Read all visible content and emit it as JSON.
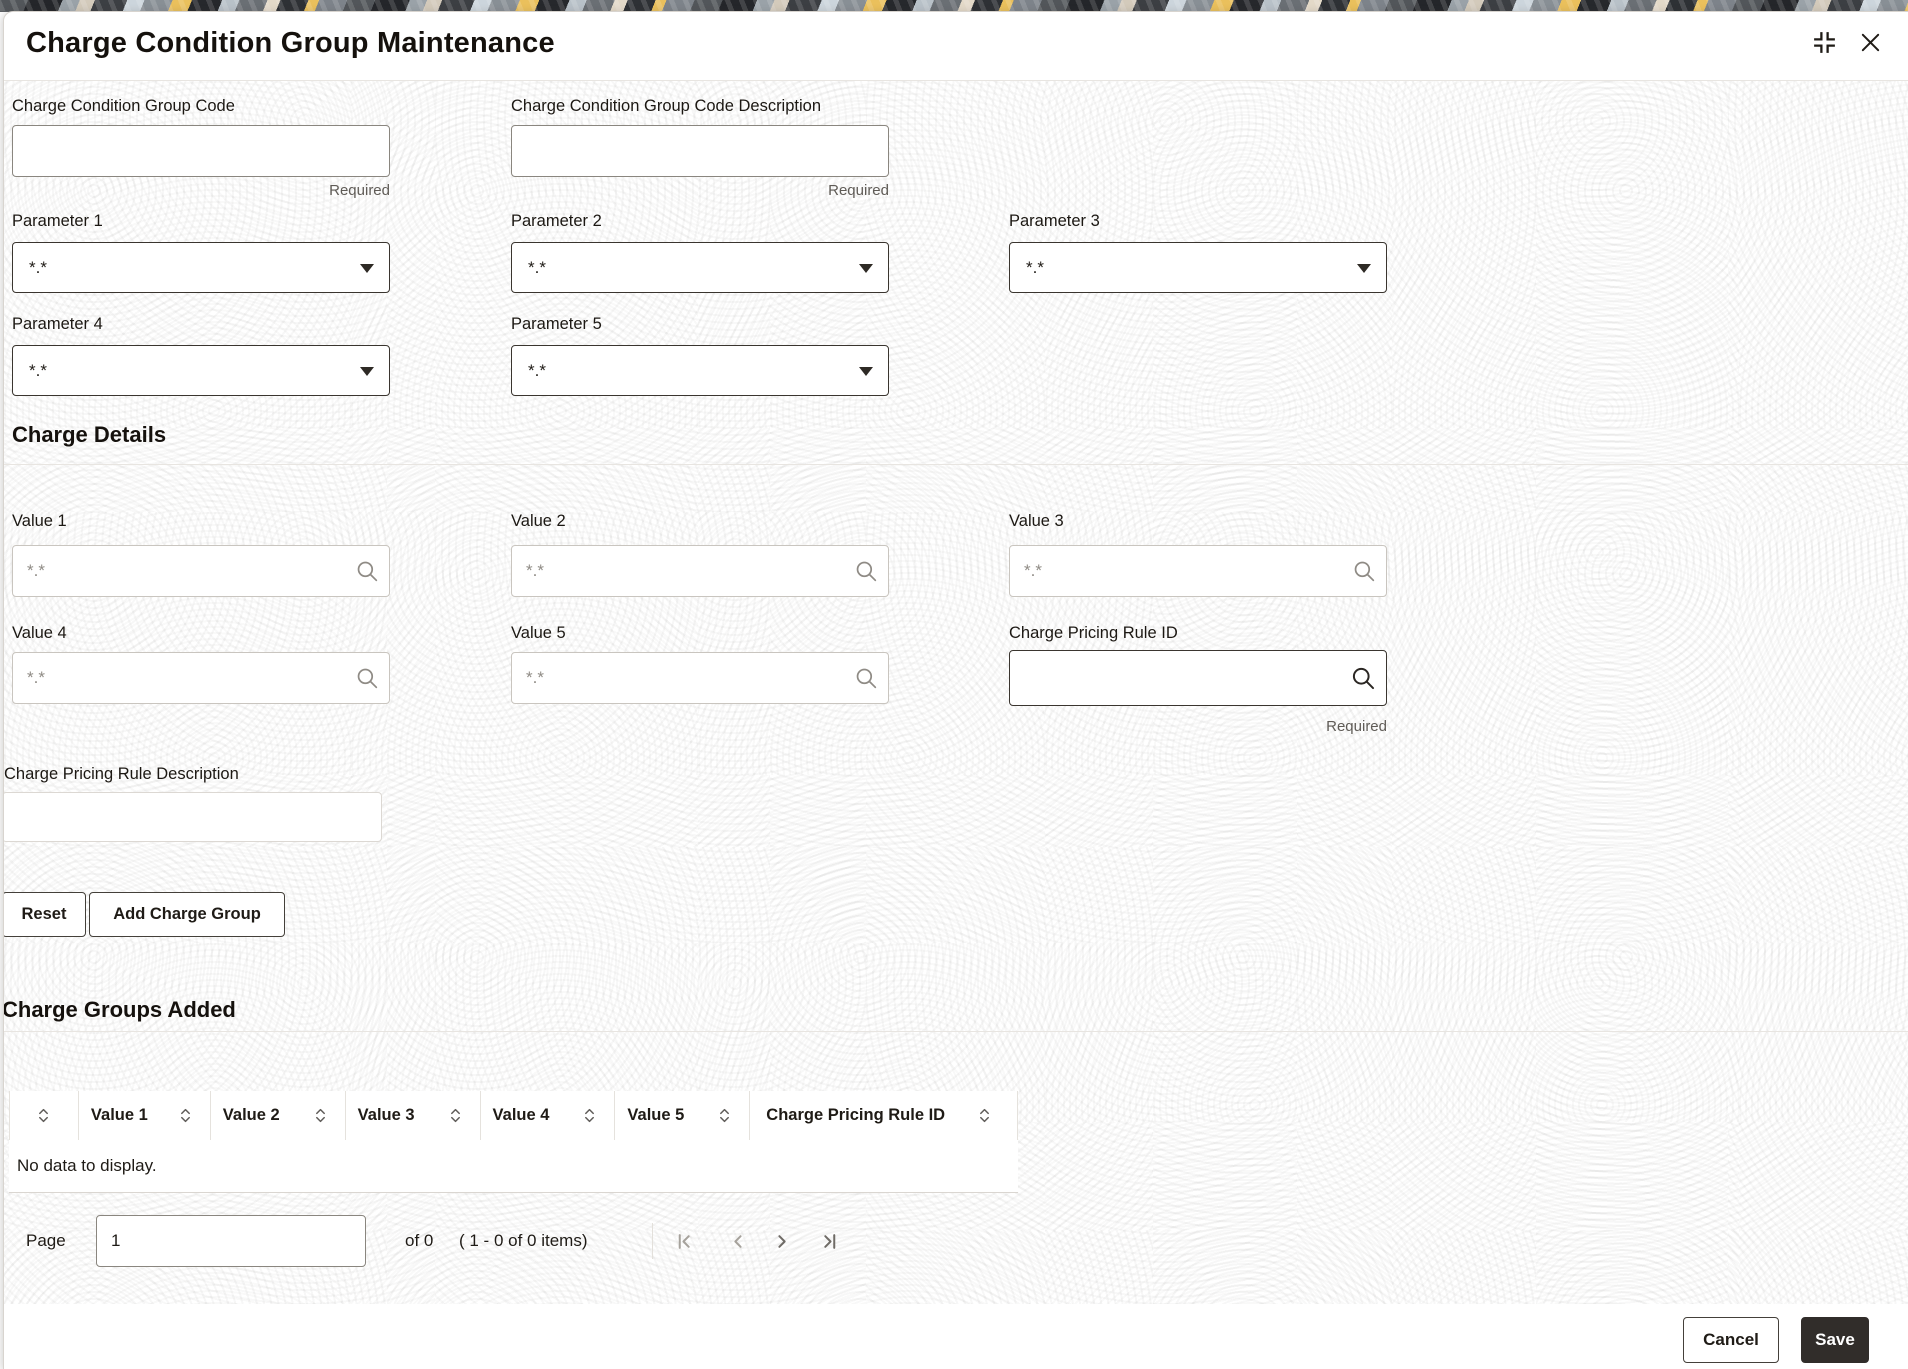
{
  "dialog_title": "Charge Condition Group Maintenance",
  "form": {
    "group_code": {
      "label": "Charge Condition Group Code",
      "value": "",
      "required_hint": "Required"
    },
    "group_code_description": {
      "label": "Charge Condition Group Code Description",
      "value": "",
      "required_hint": "Required"
    }
  },
  "parameters": [
    {
      "label": "Parameter 1",
      "value": "*.*"
    },
    {
      "label": "Parameter 2",
      "value": "*.*"
    },
    {
      "label": "Parameter 3",
      "value": "*.*"
    },
    {
      "label": "Parameter 4",
      "value": "*.*"
    },
    {
      "label": "Parameter 5",
      "value": "*.*"
    }
  ],
  "charge_details_heading": "Charge Details",
  "values": [
    {
      "label": "Value 1",
      "placeholder": "*.*"
    },
    {
      "label": "Value 2",
      "placeholder": "*.*"
    },
    {
      "label": "Value 3",
      "placeholder": "*.*"
    },
    {
      "label": "Value 4",
      "placeholder": "*.*"
    },
    {
      "label": "Value 5",
      "placeholder": "*.*"
    }
  ],
  "pricing_rule": {
    "label": "Charge Pricing Rule ID",
    "value": "",
    "required_hint": "Required"
  },
  "pricing_rule_description": {
    "label": "Charge Pricing Rule Description",
    "value": ""
  },
  "buttons": {
    "reset": "Reset",
    "add_charge_group": "Add Charge Group",
    "cancel": "Cancel",
    "save": "Save"
  },
  "charge_groups": {
    "heading": "Charge Groups Added",
    "columns": [
      "Value 1",
      "Value 2",
      "Value 3",
      "Value 4",
      "Value 5",
      "Charge Pricing Rule ID"
    ],
    "empty_message": "No data to display.",
    "pagination": {
      "page_label": "Page",
      "page_value": "1",
      "of_text": "of 0",
      "range_text": "( 1 - 0 of 0 items)"
    }
  },
  "icons": {
    "collapse": "collapse-window-icon",
    "close": "close-icon",
    "search": "magnifier-icon",
    "sort": "sort-arrows-icon",
    "dropdown": "chevron-down-icon",
    "first": "first-page-icon",
    "previous": "previous-page-icon",
    "next": "next-page-icon",
    "last": "last-page-icon"
  },
  "colors": {
    "primary_button_bg": "#312d2a",
    "banner_gold": "#eac05c",
    "banner_dark": "#24262a",
    "banner_light_blue": "#ccd5dc",
    "divider": "#e8e5e1",
    "required_text": "#5f5b56"
  }
}
